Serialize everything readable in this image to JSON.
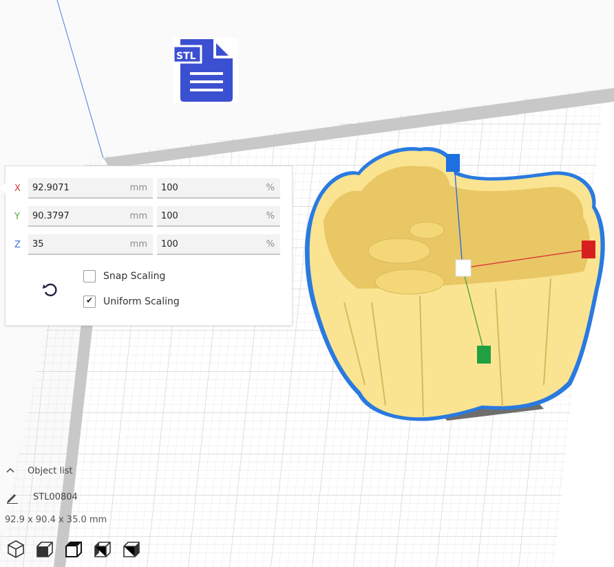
{
  "scale_panel": {
    "rows": [
      {
        "axis": "X",
        "axis_color": "#d9403a",
        "size": "92.9071",
        "size_unit": "mm",
        "percent": "100",
        "percent_unit": "%"
      },
      {
        "axis": "Y",
        "axis_color": "#5aa545",
        "size": "90.3797",
        "size_unit": "mm",
        "percent": "100",
        "percent_unit": "%"
      },
      {
        "axis": "Z",
        "axis_color": "#3b6fd6",
        "size": "35",
        "size_unit": "mm",
        "percent": "100",
        "percent_unit": "%"
      }
    ],
    "snap_scaling": {
      "label": "Snap Scaling",
      "checked": false
    },
    "uniform_scaling": {
      "label": "Uniform Scaling",
      "checked": true,
      "tick": "✔"
    },
    "reset_icon": "reset-icon"
  },
  "stl_badge": "STL",
  "object_list": {
    "header": "Object list",
    "object_name": "STL00804",
    "dimensions": "92.9 x 90.4 x 35.0 mm"
  },
  "view_buttons": [
    "3d-view-icon",
    "front-view-icon",
    "top-view-icon",
    "left-view-icon",
    "right-view-icon"
  ],
  "colors": {
    "model": "#fbe491",
    "model_shade": "#e9c765",
    "outline": "#2a7ae0",
    "grid_line": "#cfcfcf",
    "stl_blue": "#3b4fd1"
  }
}
